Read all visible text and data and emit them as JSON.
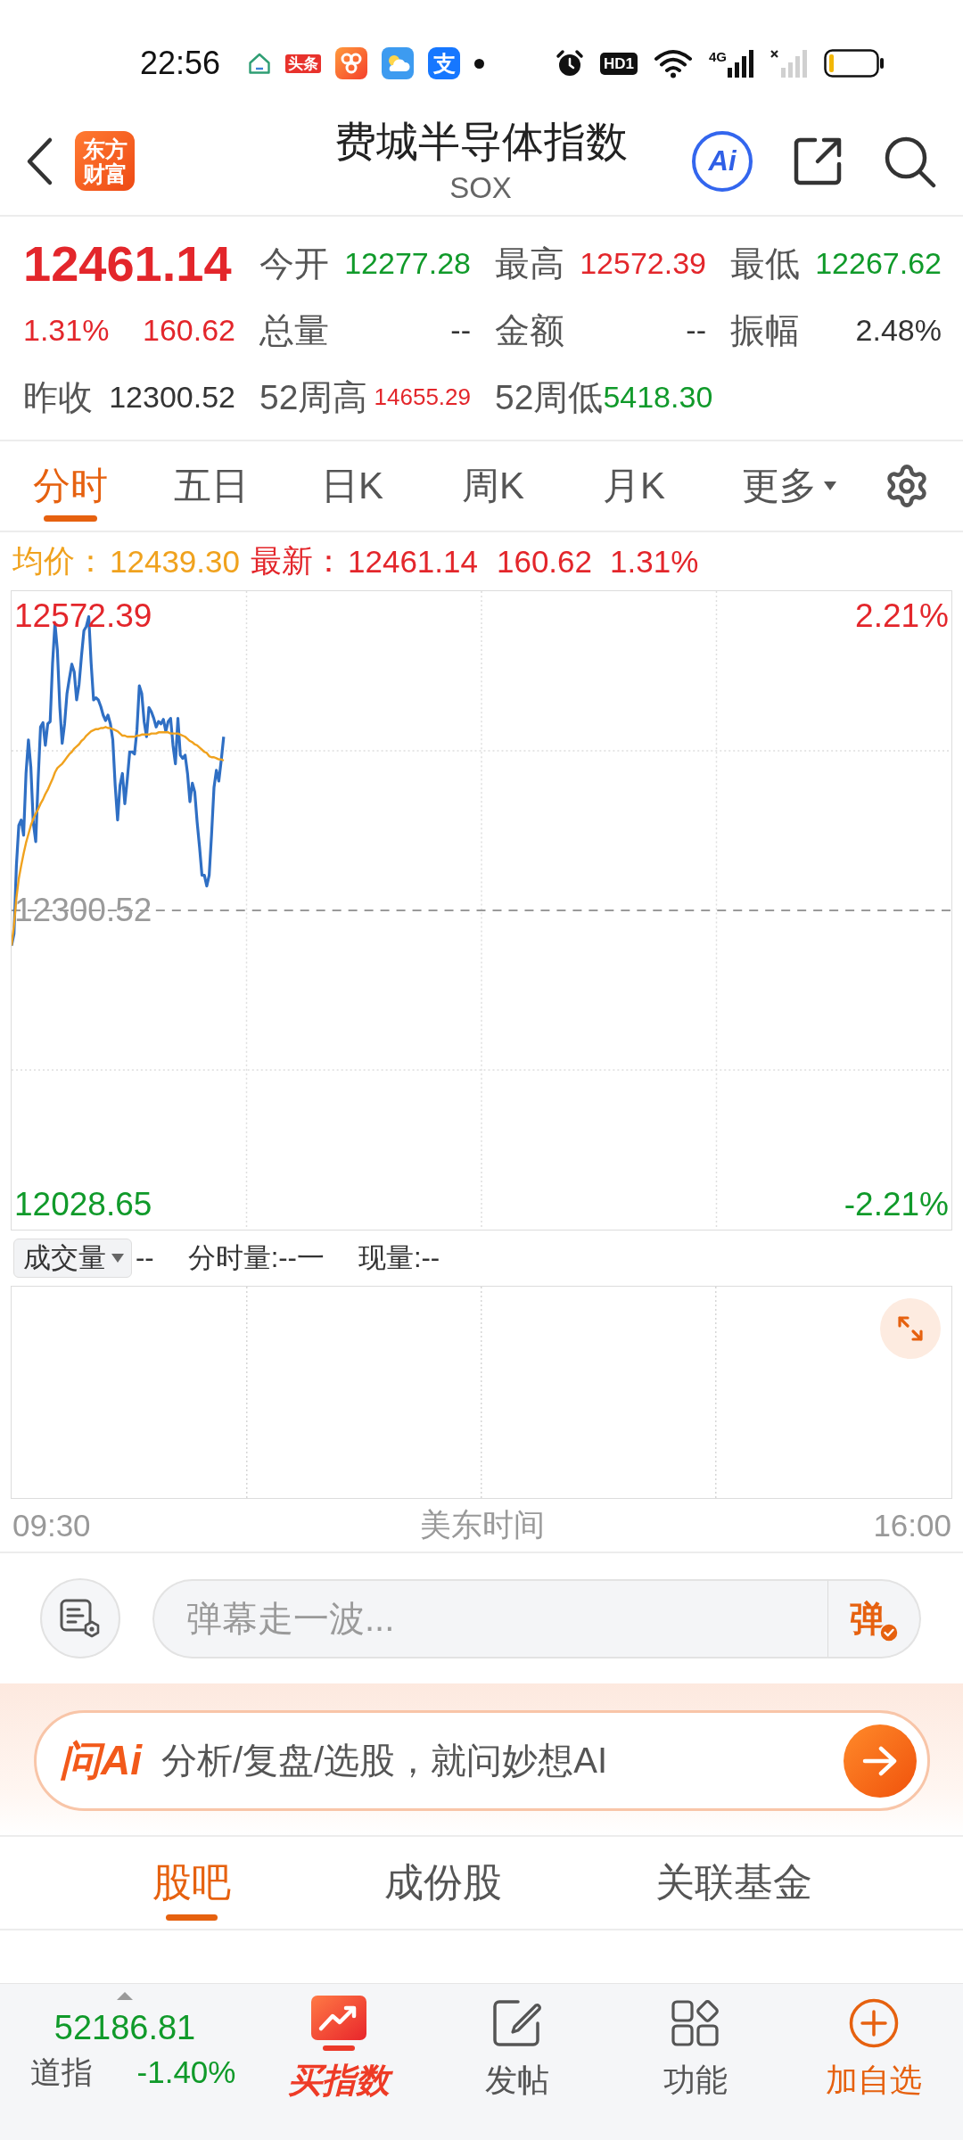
{
  "status_bar": {
    "time": "22:56",
    "notifications": [
      {
        "kind": "house"
      },
      {
        "kind": "news",
        "text": "头条"
      },
      {
        "kind": "app"
      },
      {
        "kind": "weather"
      },
      {
        "kind": "pay",
        "text": "支"
      },
      {
        "kind": "dot"
      }
    ],
    "hd_badge": "HD1",
    "network": "4G"
  },
  "header": {
    "logo": "东方财富",
    "title": "费城半导体指数",
    "subtitle": "SOX",
    "ai_button": "Ai"
  },
  "quote": {
    "rising": true,
    "price": "12461.14",
    "change_percent": "1.31%",
    "change": "160.62",
    "prev_close": {
      "name": "昨收",
      "value": "12300.52"
    },
    "stats": [
      {
        "name": "今开",
        "value": "12277.28",
        "color": "#109a2a",
        "compact": false
      },
      {
        "name": "最高",
        "value": "12572.39",
        "color": "#e3262b",
        "compact": false
      },
      {
        "name": "最低",
        "value": "12267.62",
        "color": "#109a2a",
        "compact": false
      },
      {
        "name": "总量",
        "value": "--",
        "color": "#333333",
        "compact": false
      },
      {
        "name": "金额",
        "value": "--",
        "color": "#333333",
        "compact": false
      },
      {
        "name": "振幅",
        "value": "2.48%",
        "color": "#333333",
        "compact": false
      },
      {
        "name": "52周高",
        "value": "14655.29",
        "color": "#e3262b",
        "compact": true
      },
      {
        "name": "52周低",
        "value": "5418.30",
        "color": "#109a2a",
        "compact": false
      }
    ]
  },
  "period_tabs": [
    {
      "label": "分时",
      "kind": "tab",
      "selected": true
    },
    {
      "label": "五日",
      "kind": "tab",
      "selected": false
    },
    {
      "label": "日K",
      "kind": "tab",
      "selected": false
    },
    {
      "label": "周K",
      "kind": "tab",
      "selected": false
    },
    {
      "label": "月K",
      "kind": "tab",
      "selected": false
    },
    {
      "label": "更多",
      "kind": "menu",
      "selected": false
    }
  ],
  "summary": {
    "avg_label": "均价：",
    "avg_value": "12439.30",
    "latest_label": "最新：",
    "latest_value": "12461.14",
    "latest_change": "160.62",
    "latest_percent": "1.31%"
  },
  "price_chart": {
    "high_percent": "2.21%",
    "low_percent": "-2.21%",
    "chart_data": {
      "type": "line",
      "categories": [
        null,
        null,
        null,
        null,
        null,
        null,
        null,
        null,
        null,
        null,
        null,
        null,
        null,
        null,
        null,
        null,
        null,
        null,
        null,
        null,
        null,
        null,
        null,
        null,
        null,
        null,
        null,
        null,
        null,
        null,
        null,
        null,
        null,
        null,
        null,
        null,
        null,
        null,
        null,
        null,
        null,
        null,
        null,
        null,
        null,
        null,
        null,
        null,
        null,
        null,
        null,
        null,
        null,
        null,
        null,
        null,
        null,
        null,
        null,
        null,
        null,
        null,
        null,
        null,
        null,
        null,
        null,
        null,
        null,
        null,
        null,
        null,
        null,
        null,
        null,
        null,
        null,
        null,
        null,
        null,
        null,
        null,
        null,
        null,
        null,
        null,
        null,
        null,
        null,
        null,
        null,
        null,
        null,
        null,
        null,
        null,
        null,
        null,
        null,
        null,
        null,
        null,
        null,
        null,
        null,
        null,
        null,
        null,
        null,
        null,
        null,
        null,
        null,
        null,
        null,
        null,
        null,
        null,
        null,
        null,
        null,
        null,
        null,
        null,
        null,
        null,
        null,
        null,
        null,
        null,
        null,
        null,
        null,
        null,
        null,
        null,
        null,
        null,
        null,
        null,
        null,
        null,
        null,
        null,
        null,
        null,
        null,
        null,
        null,
        null,
        null,
        null,
        null,
        null,
        null,
        null,
        null,
        null,
        null,
        null,
        null,
        null,
        null,
        null,
        null,
        null,
        null,
        null,
        null,
        null,
        null,
        null,
        null,
        null,
        null,
        null,
        null,
        null,
        null,
        null,
        null,
        null,
        null,
        null,
        null,
        null,
        null,
        null,
        null,
        null,
        null,
        null,
        null,
        null,
        null,
        null,
        null,
        null,
        null,
        null,
        null,
        null,
        null,
        null,
        null,
        null,
        null,
        null,
        null,
        null,
        null,
        null,
        null,
        null,
        null,
        null,
        null,
        null,
        null,
        null,
        null,
        null,
        null,
        null,
        null,
        null,
        null,
        null,
        null,
        null,
        null,
        null,
        null,
        null,
        null,
        null,
        null,
        null,
        null,
        null,
        null,
        null,
        null,
        null,
        null,
        null,
        null,
        null,
        null,
        null,
        null,
        null,
        null,
        null,
        null,
        null,
        null,
        null,
        null,
        null,
        null,
        null,
        null,
        null,
        null,
        null,
        null,
        null,
        null,
        null,
        null,
        null,
        null,
        null,
        null,
        null,
        null,
        null,
        null,
        null,
        null,
        null,
        null,
        null,
        null,
        null,
        null,
        null,
        null,
        null,
        null,
        null,
        null,
        null,
        null,
        null,
        null,
        null,
        null,
        null,
        null,
        null,
        null,
        null,
        null,
        null,
        null,
        null,
        null,
        null,
        null,
        null,
        null,
        null,
        null,
        null,
        null,
        null,
        null,
        null,
        null,
        null,
        null,
        null,
        null,
        null,
        null,
        null,
        null,
        null,
        null,
        null,
        null,
        null,
        null,
        null,
        null,
        null,
        null,
        null,
        null,
        null,
        null,
        null,
        null,
        null,
        null,
        null,
        null,
        null,
        null,
        null,
        null,
        null,
        null,
        null,
        null,
        null,
        null,
        null,
        null,
        null,
        null,
        null,
        null,
        null,
        null,
        null,
        null,
        null,
        null,
        null,
        null,
        null,
        null,
        null,
        null,
        null,
        null,
        null,
        null,
        null,
        null,
        null,
        null,
        null,
        null,
        null,
        null,
        null,
        null
      ],
      "series": [
        {
          "color": "#2f6fc4",
          "values": [
            12268,
            12279,
            12342,
            12379,
            12384,
            12370,
            12427,
            12458,
            12433,
            12382,
            12364,
            12421,
            12470,
            12474,
            12453,
            12473,
            12475,
            12529,
            12566,
            12541,
            12489,
            12455,
            12473,
            12501,
            12515,
            12528,
            12521,
            12495,
            12509,
            12535,
            12559,
            12563,
            12572,
            12529,
            12495,
            12497,
            12495,
            12489,
            12481,
            12476,
            12481,
            12473,
            12458,
            12416,
            12384,
            12416,
            12427,
            12399,
            12421,
            12447,
            12447,
            12445,
            12467,
            12508,
            12501,
            12475,
            12461,
            12488,
            12484,
            12478,
            12470,
            12475,
            12473,
            12477,
            12466,
            12475,
            12478,
            12453,
            12436,
            12478,
            12444,
            12441,
            12444,
            12427,
            12401,
            12418,
            12410,
            12382,
            12359,
            12333,
            12333,
            12323,
            12333,
            12371,
            12414,
            12430,
            12420,
            12439,
            12461,
            null,
            null,
            null,
            null,
            null,
            null,
            null,
            null,
            null,
            null,
            null,
            null,
            null,
            null,
            null,
            null,
            null,
            null,
            null,
            null,
            null,
            null,
            null,
            null,
            null,
            null,
            null,
            null,
            null,
            null,
            null,
            null,
            null,
            null,
            null,
            null,
            null,
            null,
            null,
            null,
            null,
            null,
            null,
            null,
            null,
            null,
            null,
            null,
            null,
            null,
            null,
            null,
            null,
            null,
            null,
            null,
            null,
            null,
            null,
            null,
            null,
            null,
            null,
            null,
            null,
            null,
            null,
            null,
            null,
            null,
            null,
            null,
            null,
            null,
            null,
            null,
            null,
            null,
            null,
            null,
            null,
            null,
            null,
            null,
            null,
            null,
            null,
            null,
            null,
            null,
            null,
            null,
            null,
            null,
            null,
            null,
            null,
            null,
            null,
            null,
            null,
            null,
            null,
            null,
            null,
            null,
            null,
            null,
            null,
            null,
            null,
            null,
            null,
            null,
            null,
            null,
            null,
            null,
            null,
            null,
            null,
            null,
            null,
            null,
            null,
            null,
            null,
            null,
            null,
            null,
            null,
            null,
            null,
            null,
            null,
            null,
            null,
            null,
            null,
            null,
            null,
            null,
            null,
            null,
            null,
            null,
            null,
            null,
            null,
            null,
            null,
            null,
            null,
            null,
            null,
            null,
            null,
            null,
            null,
            null,
            null,
            null,
            null,
            null,
            null,
            null,
            null,
            null,
            null,
            null,
            null,
            null,
            null,
            null,
            null,
            null,
            null,
            null,
            null,
            null,
            null,
            null,
            null,
            null,
            null,
            null,
            null,
            null,
            null,
            null,
            null,
            null,
            null,
            null,
            null,
            null,
            null,
            null,
            null,
            null,
            null,
            null,
            null,
            null,
            null,
            null,
            null,
            null,
            null,
            null,
            null,
            null,
            null,
            null,
            null,
            null,
            null,
            null,
            null,
            null,
            null,
            null,
            null,
            null,
            null,
            null,
            null,
            null,
            null,
            null,
            null,
            null,
            null,
            null,
            null,
            null,
            null,
            null,
            null,
            null,
            null,
            null,
            null,
            null,
            null,
            null,
            null,
            null,
            null,
            null,
            null,
            null,
            null,
            null,
            null,
            null,
            null,
            null,
            null,
            null,
            null,
            null,
            null,
            null,
            null,
            null,
            null,
            null,
            null,
            null,
            null,
            null,
            null,
            null,
            null,
            null,
            null,
            null,
            null,
            null,
            null,
            null,
            null,
            null,
            null,
            null,
            null,
            null,
            null,
            null,
            null,
            null,
            null,
            null,
            null,
            null,
            null,
            null,
            null,
            null,
            null,
            null
          ]
        },
        {
          "color": "#f0a21e",
          "values": [
            12268,
            12287,
            12312,
            12330,
            12342,
            12353,
            12363,
            12371,
            12379,
            12385,
            12390,
            12394,
            12399,
            12403,
            12408,
            12412,
            12417,
            12422,
            12428,
            12432,
            12434,
            12436,
            12439,
            12442,
            12445,
            12447,
            12450,
            12452,
            12454,
            12457,
            12459,
            12462,
            12464,
            12466,
            12467,
            12468,
            12468,
            12469,
            12469,
            12470,
            12469,
            12469,
            12468,
            12467,
            12466,
            12464,
            12462,
            12462,
            12461,
            12461,
            12461,
            12461,
            12462,
            12462,
            12463,
            12463,
            12463,
            12463,
            12464,
            12464,
            12464,
            12465,
            12465,
            12465,
            12465,
            12465,
            12464,
            12464,
            12464,
            12464,
            12463,
            12462,
            12461,
            12459,
            12457,
            12456,
            12454,
            12453,
            12451,
            12449,
            12447,
            12446,
            12443,
            12442,
            12442,
            12441,
            12440,
            12440,
            12439,
            null,
            null,
            null,
            null,
            null,
            null,
            null,
            null,
            null,
            null,
            null,
            null,
            null,
            null,
            null,
            null,
            null,
            null,
            null,
            null,
            null,
            null,
            null,
            null,
            null,
            null,
            null,
            null,
            null,
            null,
            null,
            null,
            null,
            null,
            null,
            null,
            null,
            null,
            null,
            null,
            null,
            null,
            null,
            null,
            null,
            null,
            null,
            null,
            null,
            null,
            null,
            null,
            null,
            null,
            null,
            null,
            null,
            null,
            null,
            null,
            null,
            null,
            null,
            null,
            null,
            null,
            null,
            null,
            null,
            null,
            null,
            null,
            null,
            null,
            null,
            null,
            null,
            null,
            null,
            null,
            null,
            null,
            null,
            null,
            null,
            null,
            null,
            null,
            null,
            null,
            null,
            null,
            null,
            null,
            null,
            null,
            null,
            null,
            null,
            null,
            null,
            null,
            null,
            null,
            null,
            null,
            null,
            null,
            null,
            null,
            null,
            null,
            null,
            null,
            null,
            null,
            null,
            null,
            null,
            null,
            null,
            null,
            null,
            null,
            null,
            null,
            null,
            null,
            null,
            null,
            null,
            null,
            null,
            null,
            null,
            null,
            null,
            null,
            null,
            null,
            null,
            null,
            null,
            null,
            null,
            null,
            null,
            null,
            null,
            null,
            null,
            null,
            null,
            null,
            null,
            null,
            null,
            null,
            null,
            null,
            null,
            null,
            null,
            null,
            null,
            null,
            null,
            null,
            null,
            null,
            null,
            null,
            null,
            null,
            null,
            null,
            null,
            null,
            null,
            null,
            null,
            null,
            null,
            null,
            null,
            null,
            null,
            null,
            null,
            null,
            null,
            null,
            null,
            null,
            null,
            null,
            null,
            null,
            null,
            null,
            null,
            null,
            null,
            null,
            null,
            null,
            null,
            null,
            null,
            null,
            null,
            null,
            null,
            null,
            null,
            null,
            null,
            null,
            null,
            null,
            null,
            null,
            null,
            null,
            null,
            null,
            null,
            null,
            null,
            null,
            null,
            null,
            null,
            null,
            null,
            null,
            null,
            null,
            null,
            null,
            null,
            null,
            null,
            null,
            null,
            null,
            null,
            null,
            null,
            null,
            null,
            null,
            null,
            null,
            null,
            null,
            null,
            null,
            null,
            null,
            null,
            null,
            null,
            null,
            null,
            null,
            null,
            null,
            null,
            null,
            null,
            null,
            null,
            null,
            null,
            null,
            null,
            null,
            null,
            null,
            null,
            null,
            null,
            null,
            null,
            null,
            null,
            null,
            null,
            null,
            null,
            null,
            null,
            null,
            null,
            null,
            null,
            null,
            null,
            null,
            null,
            null
          ]
        }
      ],
      "ylim": [
        12005.5,
        12595.5
      ],
      "yticks": [
        {
          "value": 12572.39,
          "label": "12572.39"
        },
        {
          "value": 12300.52,
          "label": "12300.52"
        },
        {
          "value": 12028.65,
          "label": "12028.65"
        }
      ],
      "ref_lines": [
        {
          "axis": "y",
          "value": 12300.52
        }
      ]
    }
  },
  "volume": {
    "selector": "成交量",
    "value": "--",
    "fields": [
      "分时量:--一",
      "现量:--"
    ]
  },
  "time_axis": {
    "start": "09:30",
    "title": "美东时间",
    "end": "16:00"
  },
  "danmaku": {
    "placeholder": "弹幕走一波...",
    "send_label": "弹"
  },
  "ai_bar": {
    "logo": "问Ai",
    "prompt": "分析/复盘/选股，就问妙想AI"
  },
  "section_tabs": [
    {
      "label": "股吧",
      "selected": true
    },
    {
      "label": "成份股",
      "selected": false
    },
    {
      "label": "关联基金",
      "selected": false
    }
  ],
  "bottom_bar": {
    "index_value": "52186.81",
    "index_name": "道指",
    "index_change": "-1.40%",
    "index_rising": false,
    "actions": [
      {
        "label": "买指数",
        "kind": "buy"
      },
      {
        "label": "发帖",
        "kind": "post"
      },
      {
        "label": "功能",
        "kind": "tools"
      },
      {
        "label": "加自选",
        "kind": "watch"
      }
    ]
  }
}
